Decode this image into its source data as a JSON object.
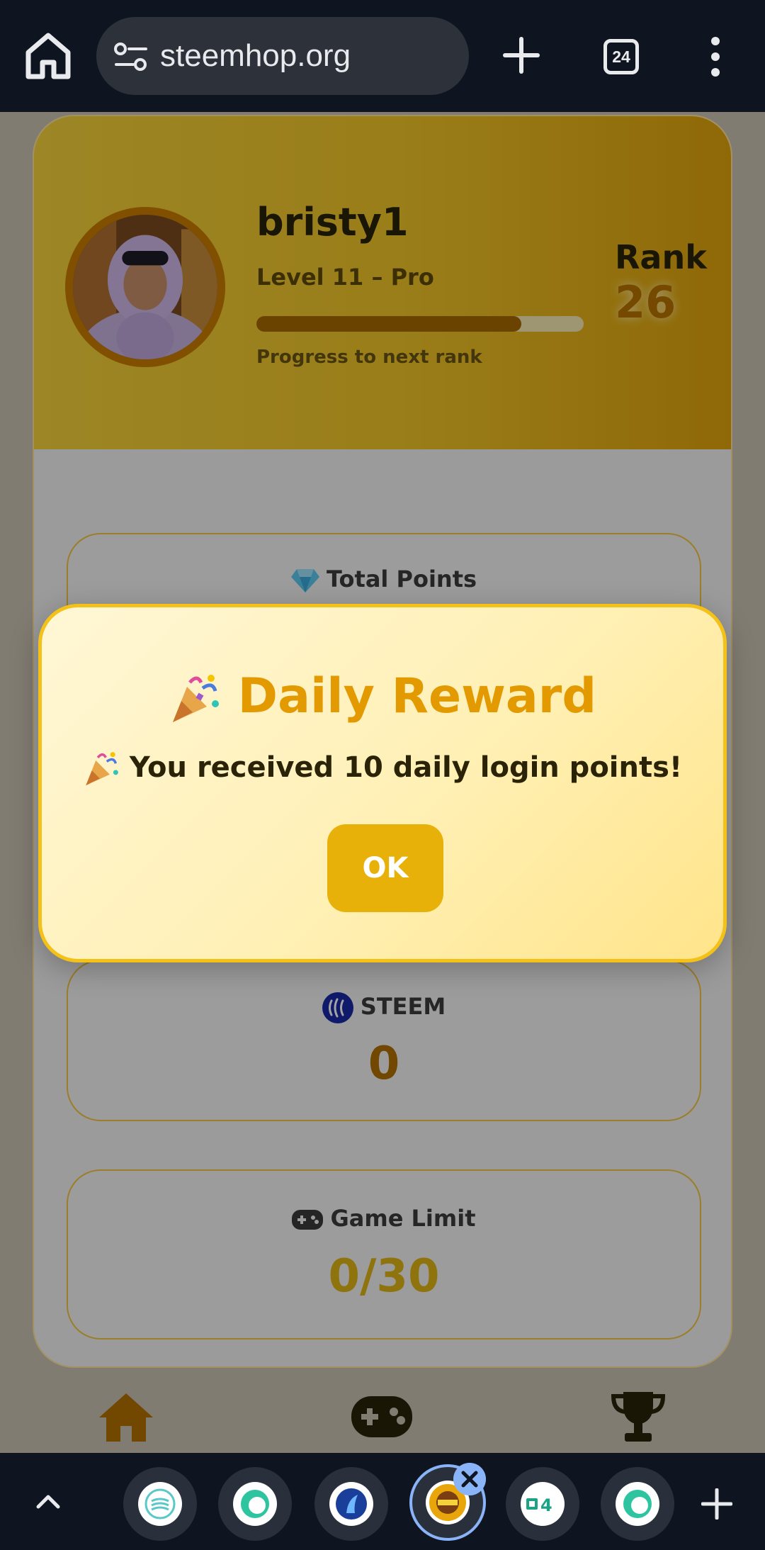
{
  "browser": {
    "url": "steemhop.org",
    "tab_count": "24"
  },
  "profile": {
    "username": "bristy1",
    "level": "Level 11 – Pro",
    "progress_fraction": 0.81,
    "progress_label": "Progress to next rank",
    "rank_label": "Rank",
    "rank_value": "26"
  },
  "stats": {
    "total_points_label": "Total Points",
    "steem_label": "STEEM",
    "steem_value": "0",
    "game_limit_label": "Game Limit",
    "game_limit_value": "0/30"
  },
  "modal": {
    "title": "Daily Reward",
    "message": "You received 10 daily login points!",
    "ok_label": "OK"
  },
  "nav": {
    "items": [
      "home-icon",
      "gamepad-icon",
      "trophy-icon"
    ]
  },
  "colors": {
    "accent": "#e8b10a",
    "header_gold": "#f0c427",
    "title_orange": "#e39a00",
    "browser_dark": "#0f1520"
  }
}
